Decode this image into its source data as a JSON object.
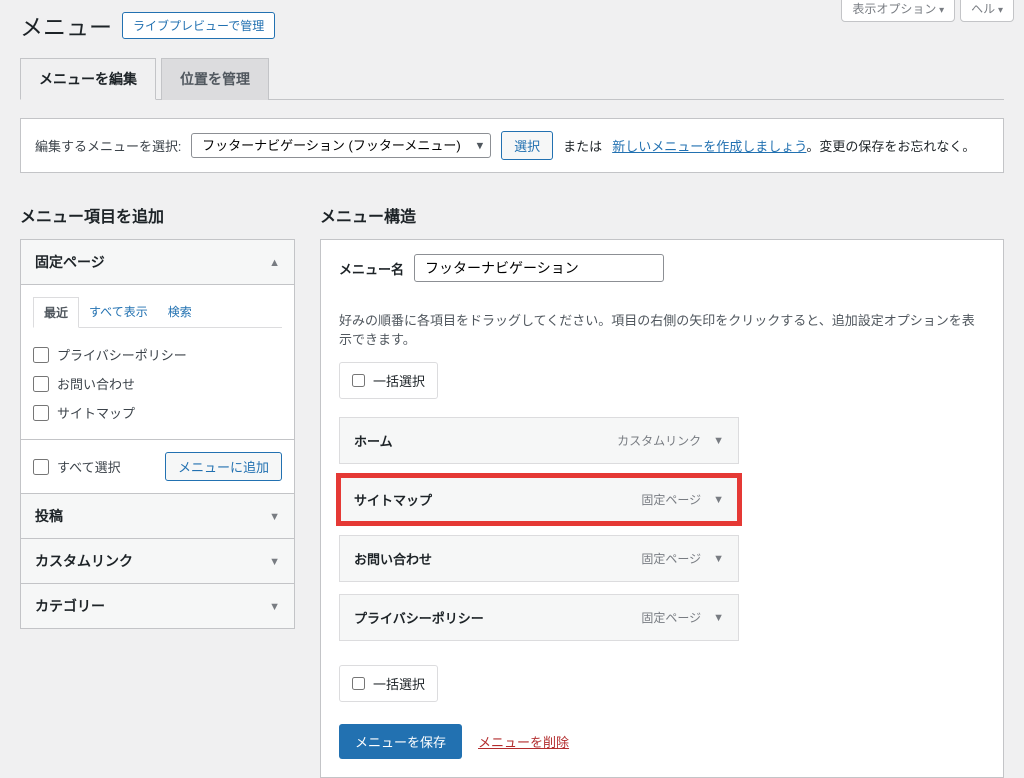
{
  "header": {
    "title": "メニュー",
    "preview_button": "ライブプレビューで管理",
    "screen_options": "表示オプション",
    "help": "ヘル"
  },
  "tabs": {
    "edit": "メニューを編集",
    "locations": "位置を管理"
  },
  "selector": {
    "label": "編集するメニューを選択:",
    "value": "フッターナビゲーション (フッターメニュー)",
    "select_btn": "選択",
    "or": "または",
    "create_link": "新しいメニューを作成しましょう",
    "dont_forget": "。変更の保存をお忘れなく。"
  },
  "left": {
    "heading": "メニュー項目を追加",
    "pages": {
      "title": "固定ページ",
      "tabs": {
        "recent": "最近",
        "all": "すべて表示",
        "search": "検索"
      },
      "items": [
        "プライバシーポリシー",
        "お問い合わせ",
        "サイトマップ"
      ],
      "select_all": "すべて選択",
      "add_btn": "メニューに追加"
    },
    "posts": "投稿",
    "custom": "カスタムリンク",
    "categories": "カテゴリー"
  },
  "right": {
    "heading": "メニュー構造",
    "name_label": "メニュー名",
    "name_value": "フッターナビゲーション",
    "help": "好みの順番に各項目をドラッグしてください。項目の右側の矢印をクリックすると、追加設定オプションを表示できます。",
    "bulk": "一括選択",
    "items": [
      {
        "title": "ホーム",
        "type": "カスタムリンク",
        "highlighted": false
      },
      {
        "title": "サイトマップ",
        "type": "固定ページ",
        "highlighted": true
      },
      {
        "title": "お問い合わせ",
        "type": "固定ページ",
        "highlighted": false
      },
      {
        "title": "プライバシーポリシー",
        "type": "固定ページ",
        "highlighted": false
      }
    ],
    "save_btn": "メニューを保存",
    "delete_link": "メニューを削除"
  }
}
